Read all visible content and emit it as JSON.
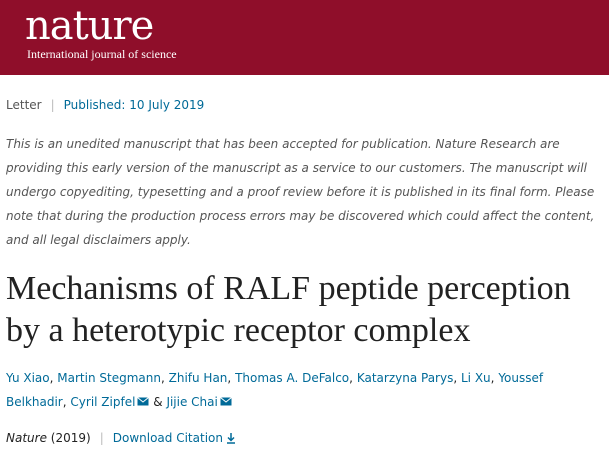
{
  "header": {
    "logo": "nature",
    "tagline": "International journal of science",
    "background_color": "#8f0e2a"
  },
  "article_meta": {
    "type": "Letter",
    "separator": "|",
    "published": "Published: 10 July 2019"
  },
  "disclaimer": "This is an unedited manuscript that has been accepted for publication. Nature Research are providing this early version of the manuscript as a service to our customers. The manuscript will undergo copyediting, typesetting and a proof review before it is published in its final form. Please note that during the production process errors may be discovered which could affect the content, and all legal disclaimers apply.",
  "title": {
    "line1": "Mechanisms of RALF peptide perception",
    "line2": "by a heterotypic receptor complex"
  },
  "authors": {
    "list": [
      "Yu Xiao",
      "Martin Stegmann",
      "Zhifu Han",
      "Thomas A. DeFalco",
      "Katarzyna Parys",
      "Li Xu",
      "Youssef Belkhadir",
      "Cyril Zipfel",
      "Jijie Chai"
    ],
    "comma": ",",
    "ampersand": "&",
    "link_color": "#006a98"
  },
  "citation": {
    "journal": "Nature",
    "year": "(2019)",
    "separator": "|",
    "download_label": "Download Citation",
    "icon": "download-icon"
  }
}
